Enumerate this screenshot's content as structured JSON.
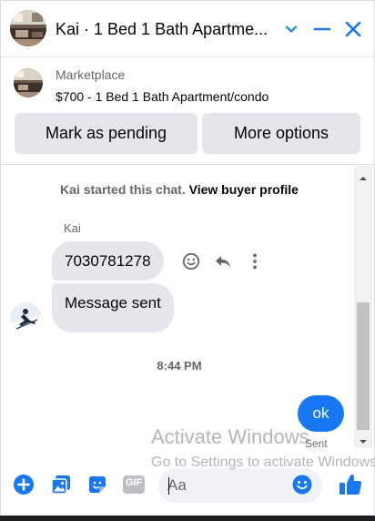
{
  "header": {
    "title": "Kai · 1 Bed 1 Bath Apartme...",
    "avatar_icon": "apartment-photo",
    "chevron_icon": "chevron-down-icon",
    "minimize_icon": "minimize-icon",
    "close_icon": "close-icon",
    "accent_color": "#1877f2"
  },
  "listing": {
    "source": "Marketplace",
    "title": "$700 - 1 Bed 1 Bath Apartment/condo",
    "mark_pending_label": "Mark as pending",
    "more_options_label": "More options"
  },
  "conversation": {
    "system_text": "Kai started this chat.",
    "system_link": "View buyer profile",
    "sender_name": "Kai",
    "incoming": [
      {
        "text": "7030781278"
      },
      {
        "text": "Message sent"
      }
    ],
    "timestamp": "8:44 PM",
    "outgoing": [
      {
        "text": "ok",
        "status": "Sent"
      }
    ],
    "outgoing_color": "#1877f2"
  },
  "watermark": {
    "title": "Activate Windows",
    "subtitle": "Go to Settings to activate Windows."
  },
  "composer": {
    "placeholder": "Aa",
    "gif_label": "GIF",
    "icons": [
      "plus-circle-icon",
      "photo-icon",
      "sticker-icon",
      "gif-icon",
      "emoji-icon",
      "thumbs-up-icon"
    ]
  }
}
